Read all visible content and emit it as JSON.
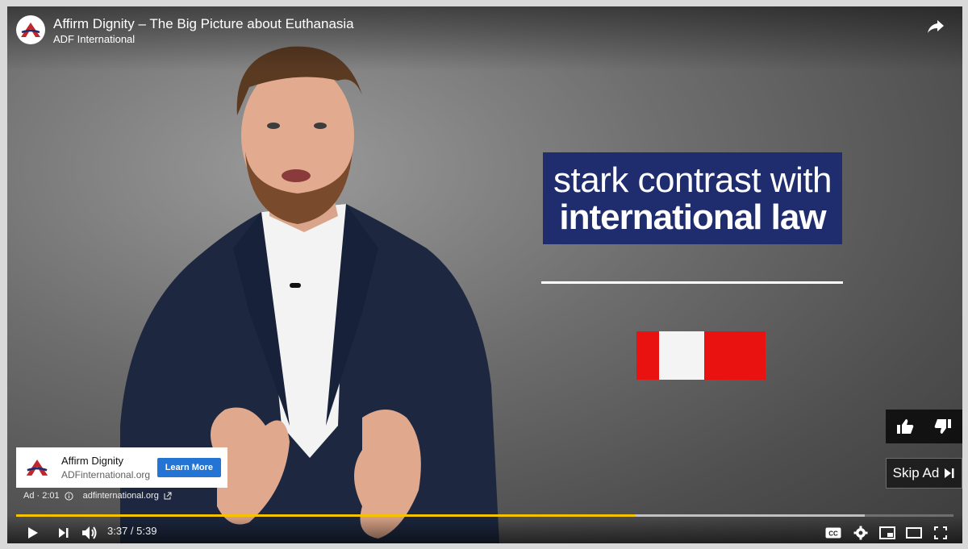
{
  "video": {
    "title": "Affirm Dignity – The Big Picture about Euthanasia",
    "channel": "ADF International",
    "share_icon": "share-icon"
  },
  "overlay": {
    "line1": "stark contrast with",
    "line2": "international law"
  },
  "rating": {
    "like_icon": "thumbs-up-icon",
    "dislike_icon": "thumbs-down-icon"
  },
  "skip_ad": {
    "label": "Skip Ad"
  },
  "ad_card": {
    "title": "Affirm Dignity",
    "url": "ADFinternational.org",
    "cta": "Learn More",
    "cta_color": "#2474d4"
  },
  "ad_meta": {
    "label": "Ad · 2:01",
    "domain": "adfinternational.org"
  },
  "progress": {
    "played_fraction": 0.66,
    "buffered_fraction": 0.905,
    "played_color": "#f6c200"
  },
  "controls": {
    "time": "3:37 / 5:39"
  },
  "colors": {
    "caption_bg": "#1f2d6e",
    "flag_red": "#ea1111"
  }
}
